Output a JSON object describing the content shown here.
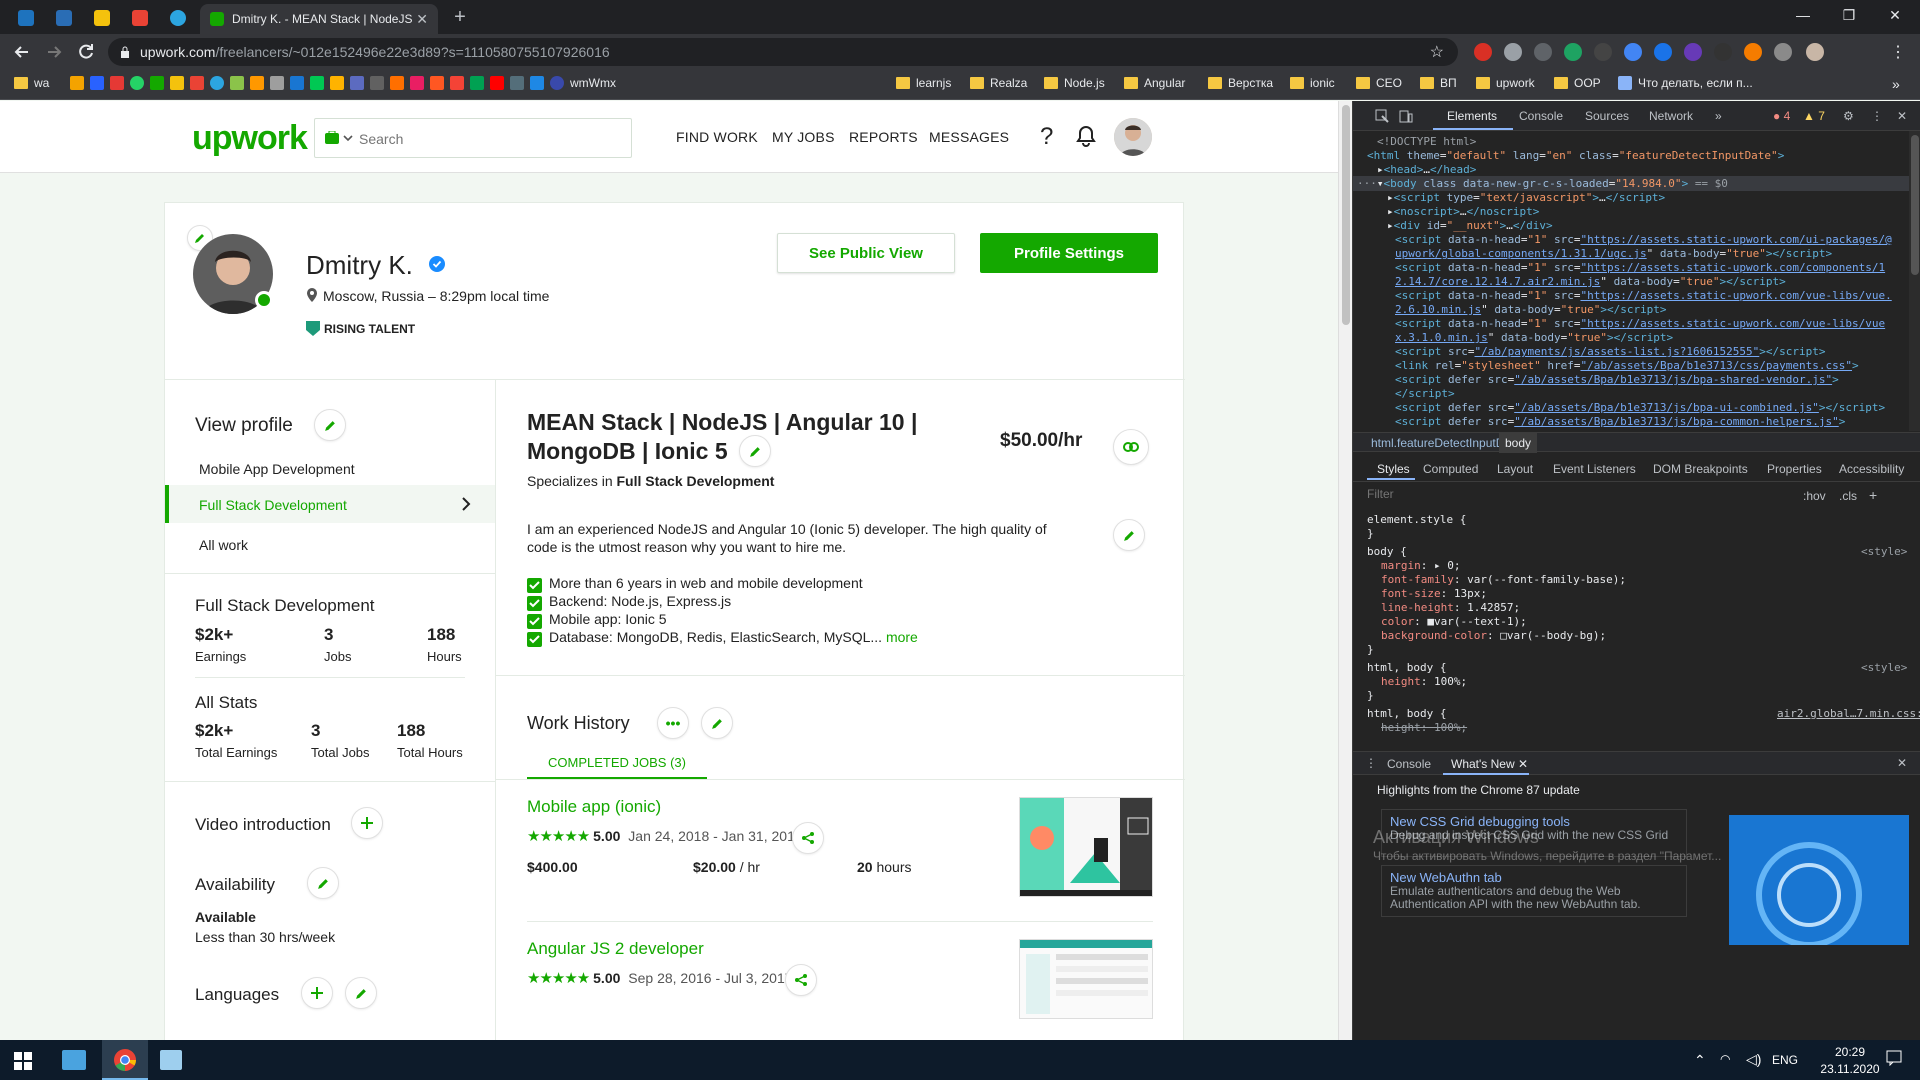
{
  "browser": {
    "active_tab_title": "Dmitry K. - MEAN Stack | NodeJS",
    "url_host": "upwork.com",
    "url_path": "/freelancers/~012e152496e22e3d89?s=1110580755107926016",
    "bookmarks": [
      "wa",
      "wmWmx",
      "learnjs",
      "Realza",
      "Node.js",
      "Angular",
      "Верстка",
      "ionic",
      "CEO",
      "ВП",
      "upwork",
      "OOP",
      "Что делать, если п..."
    ]
  },
  "nav": {
    "logo": "upwork",
    "search_placeholder": "Search",
    "links": [
      "FIND WORK",
      "MY JOBS",
      "REPORTS",
      "MESSAGES"
    ]
  },
  "profile": {
    "name": "Dmitry K.",
    "location": "Moscow, Russia – 8:29pm local time",
    "badge": "RISING TALENT",
    "btn_public": "See Public View",
    "btn_settings": "Profile Settings"
  },
  "sidebar": {
    "view_profile": "View profile",
    "items": [
      "Mobile App Development",
      "Full Stack Development",
      "All work"
    ],
    "section_title": "Full Stack Development",
    "stats": [
      {
        "v": "$2k+",
        "l": "Earnings"
      },
      {
        "v": "3",
        "l": "Jobs"
      },
      {
        "v": "188",
        "l": "Hours"
      }
    ],
    "all_stats_title": "All Stats",
    "all_stats": [
      {
        "v": "$2k+",
        "l": "Total Earnings"
      },
      {
        "v": "3",
        "l": "Total Jobs"
      },
      {
        "v": "188",
        "l": "Total Hours"
      }
    ],
    "video": "Video introduction",
    "availability": "Availability",
    "available": "Available",
    "hours": "Less than 30 hrs/week",
    "languages": "Languages"
  },
  "main": {
    "title_line1": "MEAN Stack | NodeJS | Angular 10 |",
    "title_line2": "MongoDB | Ionic 5",
    "specializes_prefix": "Specializes in",
    "specializes": "Full Stack Development",
    "rate": "$50.00/hr",
    "desc_line1": "I am an experienced NodeJS and Angular 10 (Ionic 5) developer. The high quality of",
    "desc_line2": "code is the utmost reason why you want to hire me.",
    "bullets": [
      "More than 6 years in web and mobile development",
      "Backend: Node.js, Express.js",
      "Mobile app: Ionic 5",
      "Database: MongoDB, Redis, ElasticSearch, MySQL..."
    ],
    "more": "more",
    "work_history": "Work History",
    "completed_tab": "COMPLETED JOBS (3)",
    "jobs": [
      {
        "title": "Mobile app (ionic)",
        "rating": "5.00",
        "dates": "Jan 24, 2018 - Jan 31, 2018",
        "total": "$400.00",
        "rate": "$20.00",
        "rate_unit": "/ hr",
        "hours": "20",
        "hours_unit": "hours"
      },
      {
        "title": "Angular JS 2 developer",
        "rating": "5.00",
        "dates": "Sep 28, 2016 - Jul 3, 2017"
      }
    ]
  },
  "devtools": {
    "tabs": [
      "Elements",
      "Console",
      "Sources",
      "Network"
    ],
    "errors": "4",
    "warnings": "7",
    "breadcrumb": [
      "html.featureDetectInputDate",
      "body"
    ],
    "style_tabs": [
      "Styles",
      "Computed",
      "Layout",
      "Event Listeners",
      "DOM Breakpoints",
      "Properties",
      "Accessibility"
    ],
    "filter_placeholder": "Filter",
    "hov": ":hov",
    "cls": ".cls",
    "drawer_tabs": [
      "Console",
      "What's New"
    ],
    "highlights": "Highlights from the Chrome 87 update",
    "news": [
      {
        "title": "New CSS Grid debugging tools",
        "desc": "Debug and inspect CSS Grid with the new CSS Grid debugging tools."
      },
      {
        "title": "New WebAuthn tab",
        "desc": "Emulate authenticators and debug the Web Authentication API with the new WebAuthn tab."
      }
    ],
    "watermark_line1": "Активация Windows",
    "watermark_line2": "Чтобы активировать Windows, перейдите в раздел \"Парамет..."
  },
  "taskbar": {
    "lang": "ENG",
    "time": "20:29",
    "date": "23.11.2020"
  }
}
